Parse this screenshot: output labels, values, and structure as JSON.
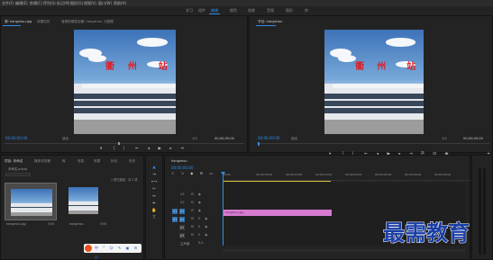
{
  "menu": [
    "文件(F)",
    "编辑(E)",
    "剪辑(C)",
    "序列(S)",
    "标记(M)",
    "图形(G)",
    "视图(V)",
    "窗口(W)",
    "帮助(H)"
  ],
  "workspaces": {
    "items": [
      "学习",
      "组件",
      "编辑",
      "颜色",
      "效果",
      "音频",
      "图形",
      "库"
    ],
    "active_index": 2
  },
  "source_panel": {
    "tabs": [
      "源: hangzhou.jpg",
      "效果控件",
      "音频剪辑混合器: hangzhou",
      "元数据"
    ],
    "timecode_left": "00;00;00;00",
    "fit": "适合",
    "ratio": "1/2",
    "timecode_right": "00;00;05;00"
  },
  "program_panel": {
    "tab": "节目: hangzhou",
    "timecode_left": "00;00;00;00",
    "fit": "适合",
    "ratio": "1/2",
    "timecode_right": "00;00;05;00"
  },
  "photo_text": {
    "chars": [
      "衢",
      "州",
      "站"
    ]
  },
  "project_panel": {
    "tabs": [
      "项目: 未命名",
      "媒体浏览器",
      "库",
      "信息",
      "效果",
      "标记",
      "历史"
    ],
    "file": "未命名.prproj",
    "count": "1 项已选择，共 2 项",
    "items": [
      {
        "name": "hangzhou.jpg",
        "duration": "5;00"
      },
      {
        "name": "hangzhou",
        "duration": "5;00"
      }
    ]
  },
  "timeline": {
    "tab": "hangzhou",
    "timecode": "00;00;00;00",
    "ruler": [
      "00;00",
      "00;00;05;00",
      "00;00;10;00",
      "00;00;15;00",
      "00;00;20;00",
      "00;00;25;00",
      "00;00;30;00",
      "00;00;35;00"
    ],
    "tracks": [
      {
        "id": "V3",
        "target": ""
      },
      {
        "id": "V2",
        "target": ""
      },
      {
        "id": "V1",
        "target": "V1"
      },
      {
        "id": "A1",
        "target": "A1"
      },
      {
        "id": "A2",
        "target": ""
      },
      {
        "id": "A3",
        "target": ""
      }
    ],
    "master": "主声道",
    "master_value": "0.0",
    "clip": {
      "label": "hangzhou.jpg",
      "color": "#d77bd0"
    }
  },
  "watermark": "最需教育",
  "colors": {
    "accent": "#2d8ceb",
    "clip": "#d77bd0",
    "watermark": "#1a3ea6"
  }
}
